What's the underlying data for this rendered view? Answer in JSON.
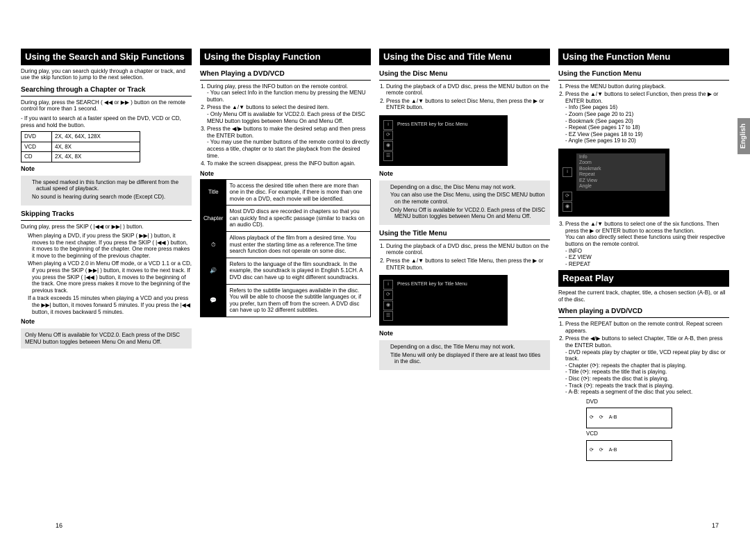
{
  "side_tab": "English",
  "col1": {
    "header": "Using the Search and Skip Functions",
    "intro": "During play, you can search quickly through a chapter or track, and use the skip function to jump to the next selection.",
    "sub1": "Searching through a Chapter or Track",
    "sub1_text1": "During play, press the SEARCH ( ◀◀ or ▶▶ ) button on the remote control for more than 1 second.",
    "sub1_text2": "- If you want to search at a faster speed on the DVD, VCD or CD, press and hold the button.",
    "speed_table": [
      [
        "DVD",
        "2X, 4X, 64X, 128X"
      ],
      [
        "VCD",
        "4X, 8X"
      ],
      [
        "CD",
        "2X, 4X, 8X"
      ]
    ],
    "note1_label": "Note",
    "note1_items": [
      "The speed marked in this function may be different from the actual speed of playback.",
      "No sound is hearing during search mode (Except CD)."
    ],
    "sub2": "Skipping Tracks",
    "sub2_text1": "During play, press the SKIP ( |◀◀ or ▶▶| ) button.",
    "sub2_items": [
      "When playing a DVD, if you press the SKIP ( ▶▶| ) button, it moves to the next chapter. If you press the SKIP ( |◀◀ ) button, it moves to the beginning of the chapter. One more press makes it move to the beginning of the previous chapter.",
      "When playing a VCD 2.0 in Menu Off mode, or a VCD 1.1 or a CD, if you press the SKIP ( ▶▶| ) button, it moves to the next track. If you press the SKIP ( |◀◀ ) button, it moves to the beginning of the track. One more press makes it move to the beginning of the previous track.",
      "If a track exceeds 15 minutes when playing a VCD and you press the ▶▶| button, it moves forward 5 minutes. If you press the |◀◀ button, it moves backward 5 minutes."
    ],
    "note2_label": "Note",
    "note2_text": "Only Menu Off is available for VCD2.0. Each press of the DISC MENU button toggles between Menu On and Menu Off."
  },
  "col2": {
    "header": "Using the Display Function",
    "sub1": "When Playing a DVD/VCD",
    "steps": [
      "During play, press the INFO button on the remote control.\n- You can select Info in the function menu by pressing the MENU button.",
      "Press the ▲/▼ buttons to select the desired item.\n- Only Menu Off is available for VCD2.0. Each press of the DISC MENU button toggles between Menu On and Menu Off.",
      "Press the ◀/▶ buttons to make the desired setup and then press the ENTER button.\n- You may use the number buttons of the remote control to directly access a title, chapter or to start the playback from the desired time.",
      "To make the screen disappear, press the INFO button again."
    ],
    "note_label": "Note",
    "display_table": [
      {
        "icon": "Title",
        "text": "To access the desired title when there are more than one in the disc. For example, if there is more than one movie on a DVD, each movie will be identified."
      },
      {
        "icon": "Chapter",
        "text": "Most DVD discs are recorded in chapters so that you can quickly find a specific passage (similar to tracks on an audio CD)."
      },
      {
        "icon": "⏱",
        "text": "Allows playback of the film from a desired time. You must enter the starting time as a reference.The time search function does not operate on some disc."
      },
      {
        "icon": "🔊",
        "text": "Refers to the language of the film soundtrack. In the example, the soundtrack is played in English 5.1CH. A DVD disc can have up to eight different soundtracks."
      },
      {
        "icon": "💬",
        "text": "Refers to the subtitle languages available in the disc. You will be able to choose the subtitle languages or, if you prefer, turn them off from the screen. A DVD disc can have up to 32 different subtitles."
      }
    ]
  },
  "col3": {
    "header": "Using the Disc and Title Menu",
    "sub1": "Using the Disc Menu",
    "sub1_steps": [
      "During the playback of a DVD disc, press the MENU button on the remote control.",
      "Press the ▲/▼ buttons to select Disc Menu, then press the ▶ or ENTER button."
    ],
    "osd1_hint": "Press ENTER key for Disc Menu",
    "note1_label": "Note",
    "note1_items": [
      "Depending on a disc, the Disc Menu may not work.",
      "You can also use the Disc Menu, using the DISC MENU button on the remote control.",
      "Only Menu Off is available for VCD2.0. Each press of the DISC MENU button toggles between Menu On and Menu Off."
    ],
    "sub2": "Using the Title Menu",
    "sub2_steps": [
      "During the playback of a DVD disc, press the MENU button on the remote control.",
      "Press the ▲/▼ buttons to select Title Menu, then press the ▶ or ENTER button."
    ],
    "osd2_hint": "Press ENTER key for Title Menu",
    "note2_label": "Note",
    "note2_items": [
      "Depending on a disc, the Title Menu may not work.",
      "Title Menu will only be displayed if there are at least two titles in the disc."
    ]
  },
  "col4": {
    "header1": "Using the Function Menu",
    "sub1": "Using the Function Menu",
    "steps1": [
      "Press the MENU button during playback.",
      "Press the ▲/▼ buttons to select Function, then press the ▶ or ENTER button.\n- Info (See pages 16)\n- Zoom (See page 20 to 21)\n- Bookmark (See pages 20)\n- Repeat (See pages 17 to 18)\n- EZ View (See pages 18 to 19)\n- Angle (See pages 19 to 20)"
    ],
    "osd_items": [
      "Info",
      "Zoom",
      "Bookmark",
      "Repeat",
      "EZ View",
      "Angle"
    ],
    "step3": "Press the ▲/▼ buttons to select one of the six functions. Then press the ▶ or ENTER button to access the function.\nYou can also directly select these functions using their respective buttons on the remote control.\n- INFO\n- EZ VIEW\n- REPEAT",
    "header2": "Repeat Play",
    "intro2": "Repeat the current track, chapter, title, a chosen section (A-B), or all of the disc.",
    "sub2": "When playing a DVD/VCD",
    "steps2": [
      "Press the REPEAT button on the remote control. Repeat screen appears.",
      "Press the ◀/▶ buttons to select Chapter, Title or A-B, then press the ENTER button.\n- DVD repeats play by chapter or title, VCD repeat play by disc or track.\n- Chapter (⟳): repeats the chapter that is playing.\n- Title (⟳): repeats the title that is playing.\n- Disc (⟳): repeats the disc that is playing.\n- Track (⟳): repeats the track that is playing.\n- A-B: repeats a segment of the disc that you select."
    ],
    "dvd_label": "DVD",
    "vcd_label": "VCD"
  },
  "page_left": "16",
  "page_right": "17"
}
